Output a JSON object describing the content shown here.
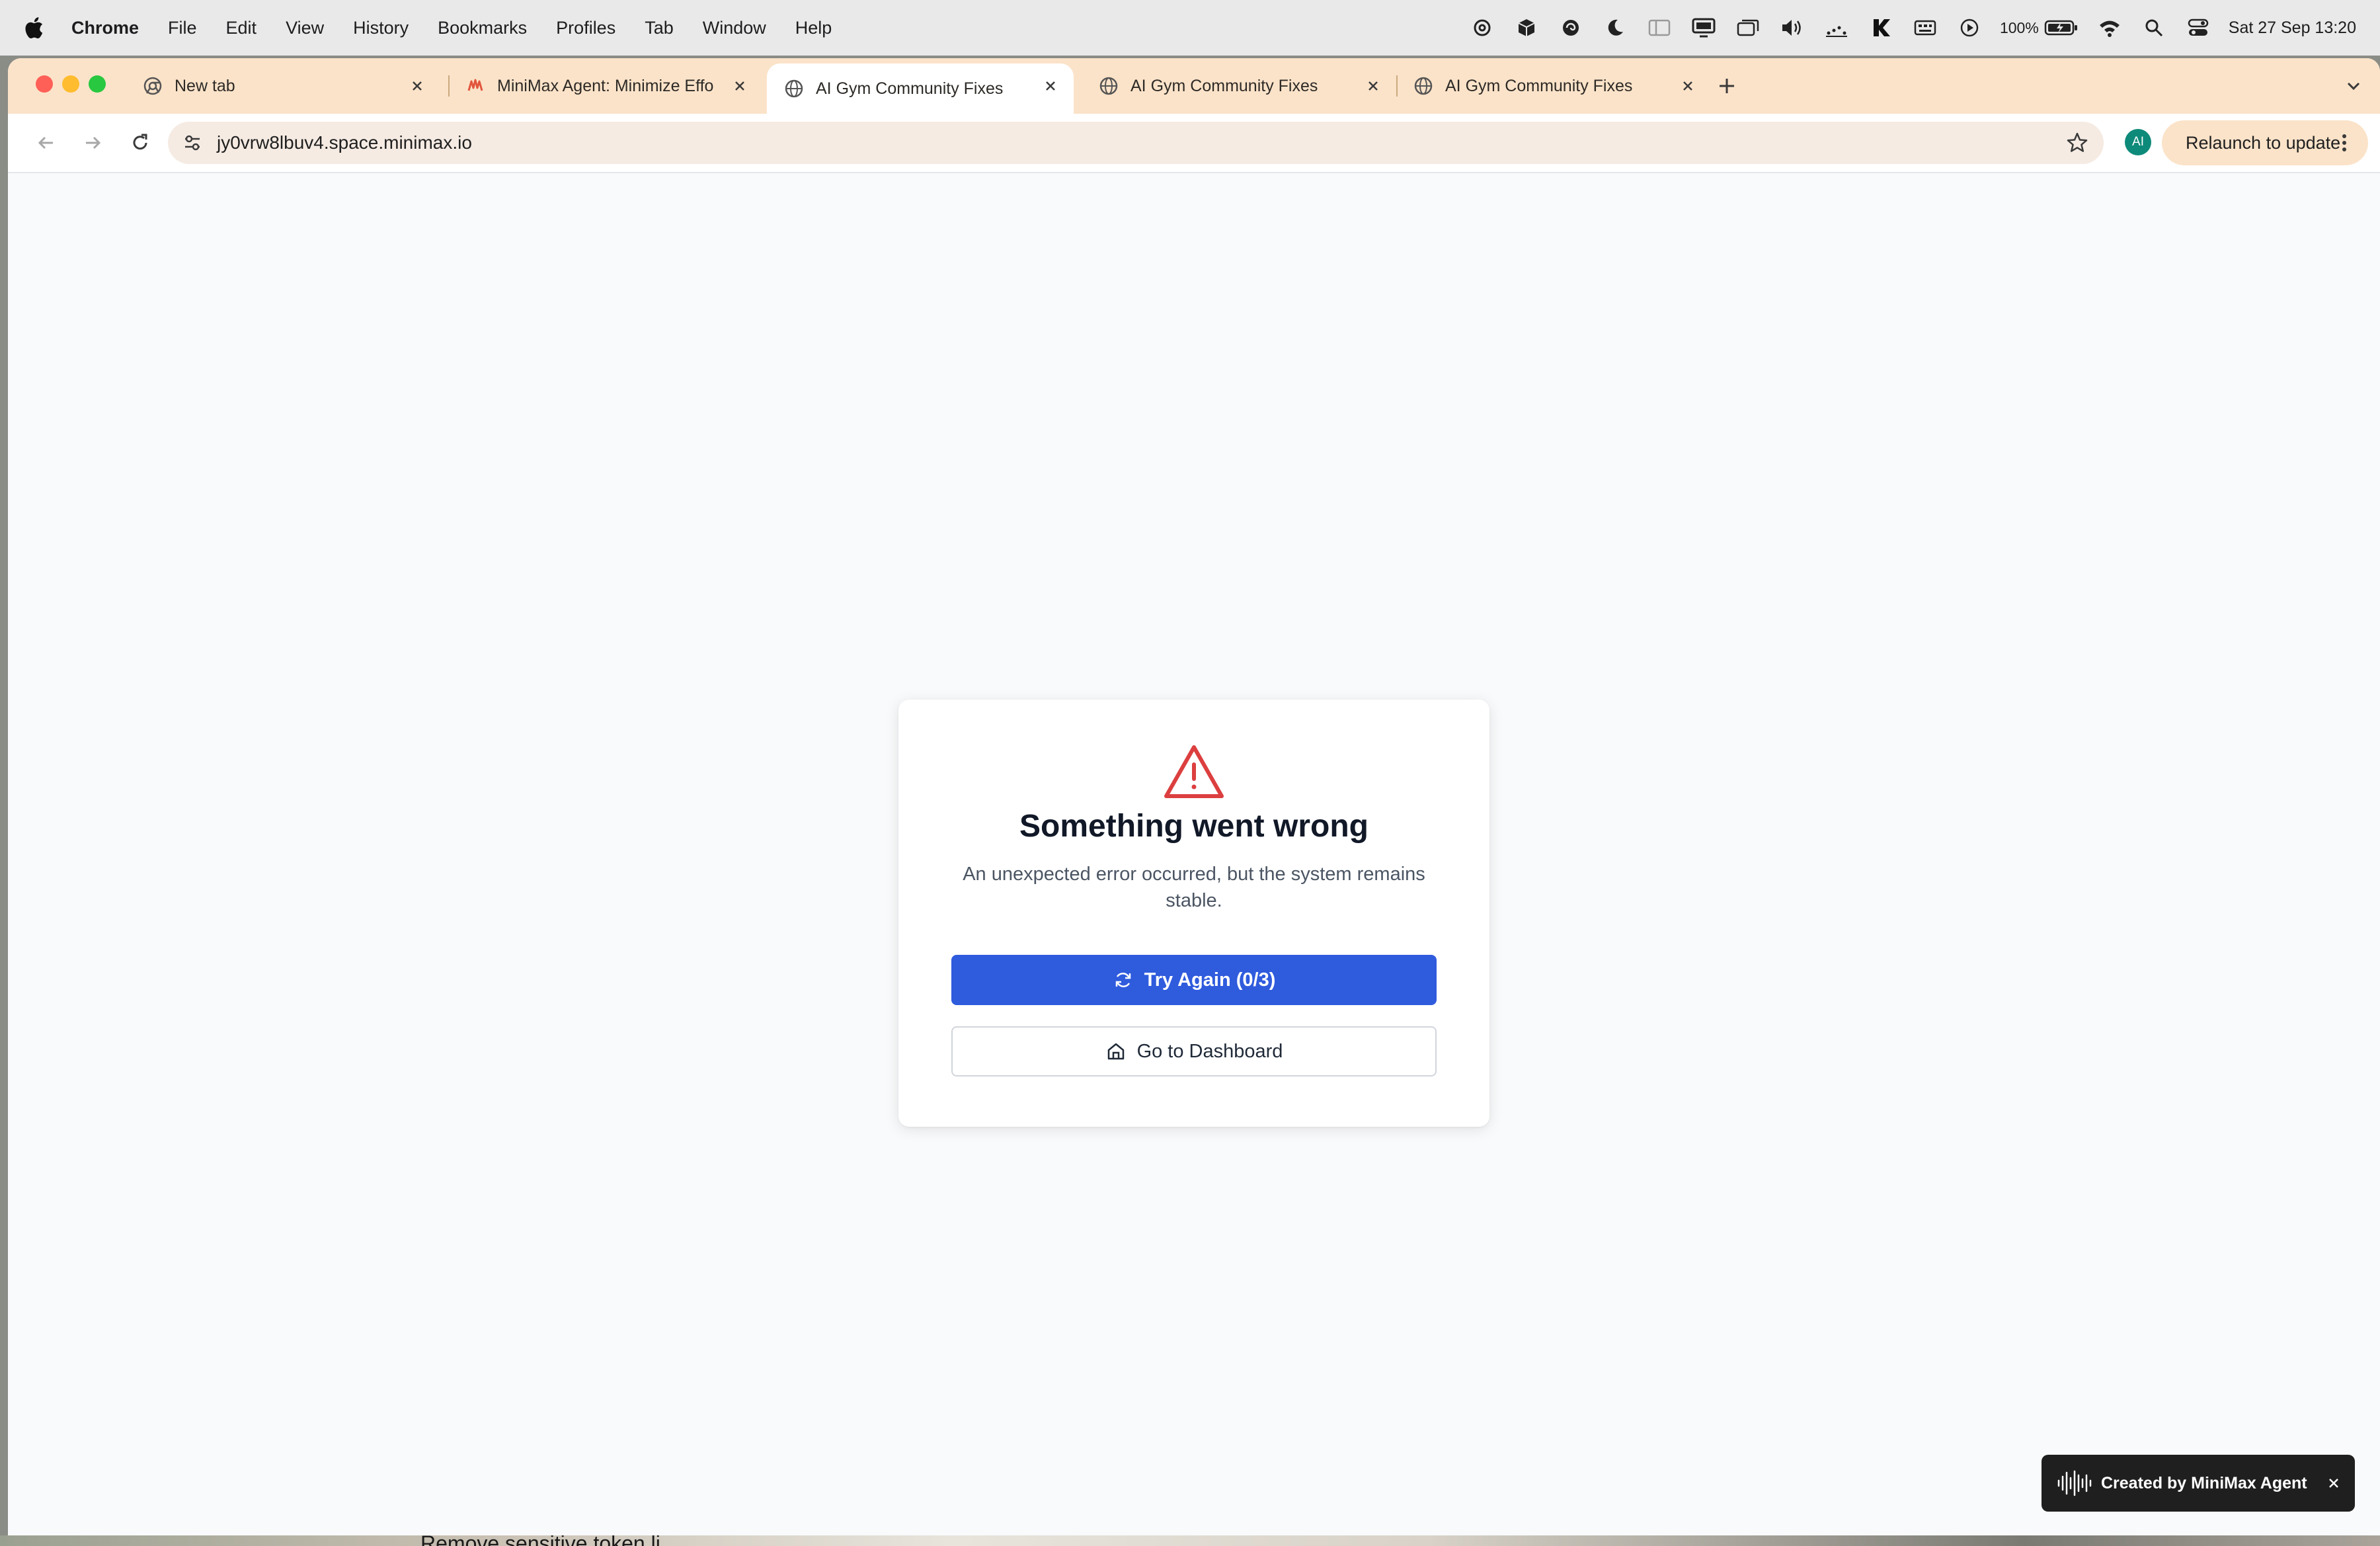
{
  "menubar": {
    "app": "Chrome",
    "items": [
      "File",
      "Edit",
      "View",
      "History",
      "Bookmarks",
      "Profiles",
      "Tab",
      "Window",
      "Help"
    ],
    "battery": "100%",
    "datetime": "Sat 27 Sep  13:20"
  },
  "tabs": [
    {
      "title": "New tab",
      "active": false
    },
    {
      "title": "MiniMax Agent: Minimize Effo",
      "active": false
    },
    {
      "title": "AI Gym Community Fixes",
      "active": true
    },
    {
      "title": "AI Gym Community Fixes",
      "active": false
    },
    {
      "title": "AI Gym Community Fixes",
      "active": false
    }
  ],
  "toolbar": {
    "url": "jy0vrw8lbuv4.space.minimax.io",
    "profile_initials": "AI",
    "relaunch_label": "Relaunch to update"
  },
  "error": {
    "title": "Something went wrong",
    "description": "An unexpected error occurred, but the system remains stable.",
    "retry_label": "Try Again (0/3)",
    "dashboard_label": "Go to Dashboard"
  },
  "badge": {
    "label": "Created by MiniMax Agent"
  },
  "background": {
    "peek_text": "Remove sensitive token li..."
  },
  "colors": {
    "primary": "#2f5bdd",
    "warning": "#dc3f3f",
    "tabstrip": "#fbe3c9"
  }
}
